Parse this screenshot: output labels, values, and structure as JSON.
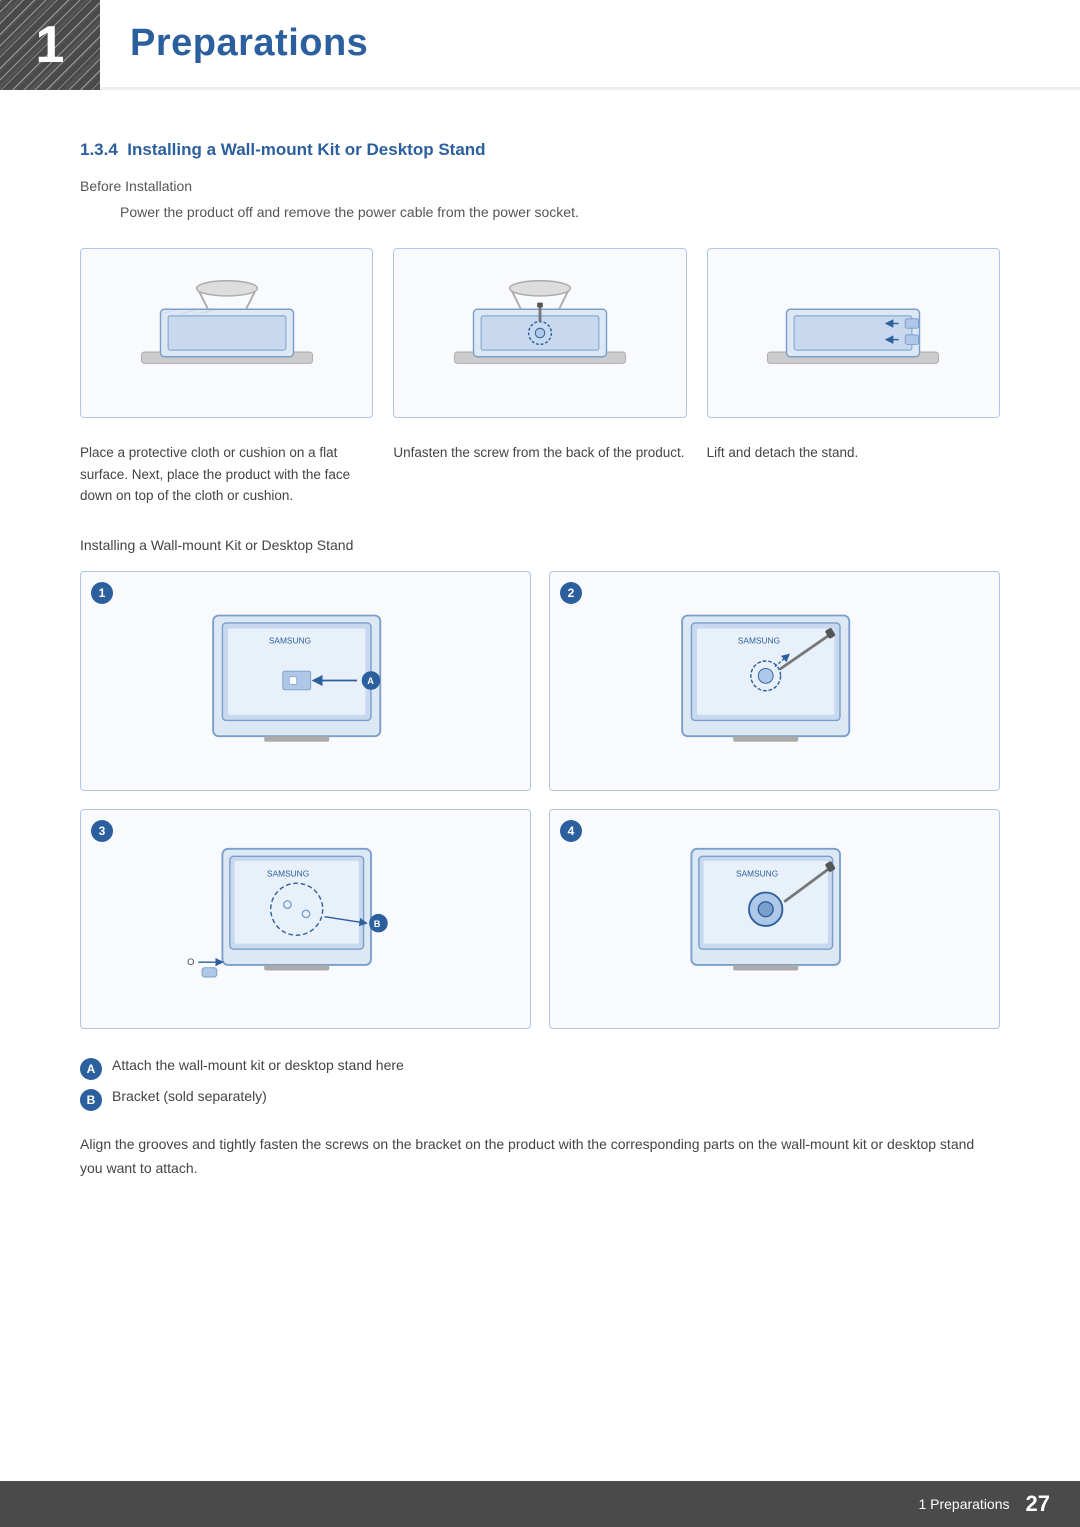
{
  "header": {
    "number": "1",
    "title": "Preparations"
  },
  "section": {
    "id": "1.3.4",
    "title": "Installing a Wall-mount Kit or Desktop Stand",
    "before_install": "Before Installation",
    "power_instruction": "Power the product off and remove the power cable from the power socket.",
    "install_label": "Installing a Wall-mount Kit or Desktop Stand",
    "captions": [
      "Place a protective cloth or cushion on a flat surface. Next, place the product with the face down on top of the cloth or cushion.",
      "Unfasten the screw from the back of the product.",
      "Lift and detach the stand."
    ],
    "steps": [
      {
        "number": "1"
      },
      {
        "number": "2"
      },
      {
        "number": "3"
      },
      {
        "number": "4"
      }
    ],
    "legend": [
      {
        "badge": "A",
        "text": "Attach the wall-mount kit or desktop stand here"
      },
      {
        "badge": "B",
        "text": "Bracket (sold separately)"
      }
    ],
    "align_text": "Align the grooves and tightly fasten the screws on the bracket on the product with the corresponding parts on the wall-mount kit or desktop stand you want to attach."
  },
  "footer": {
    "label": "1 Preparations",
    "page": "27"
  }
}
